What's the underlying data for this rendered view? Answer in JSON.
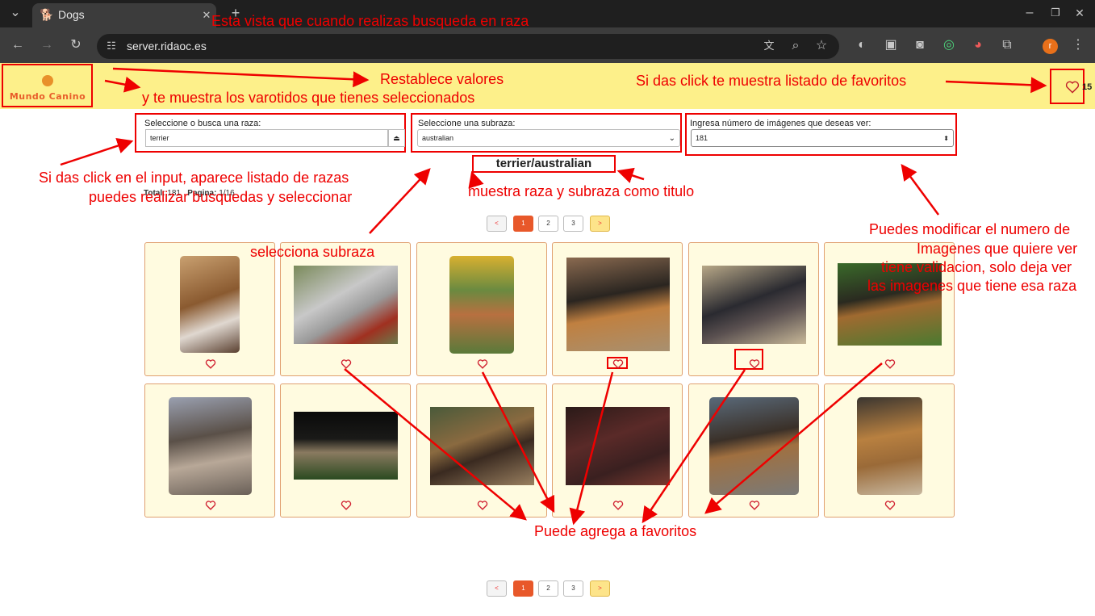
{
  "browser": {
    "tab_title": "Dogs",
    "url": "server.ridaoc.es",
    "profile_initial": "r"
  },
  "header": {
    "logo_text": "Mundo Canino",
    "favorites_count": "15"
  },
  "search": {
    "breed_label": "Seleccione o busca una raza:",
    "breed_value": "terrier",
    "subbreed_label": "Seleccione una subraza:",
    "subbreed_value": "australian",
    "count_label": "Ingresa número de imágenes que deseas ver:",
    "count_value": "181"
  },
  "title": "terrier/australian",
  "stats": {
    "total_label": "Total:",
    "total_value": "181",
    "page_label": "Pagina:",
    "page_value": "1/16"
  },
  "pagination": {
    "prev": "<",
    "pages": [
      "1",
      "2",
      "3"
    ],
    "next": ">"
  },
  "annotations": {
    "top_banner": "Esta vista que cuando realizas busqueda en raza",
    "reset_1": "Restablece valores",
    "reset_2": "y te muestra los varotidos que tienes seleccionados",
    "fav_list": "Si das click te muestra listado de favoritos",
    "input_1": "Si das click en el input, aparece listado de razas",
    "input_2": "puedes realizar busquedas y seleccionar",
    "title_note": "muestra raza y subraza como titulo",
    "subbreed_note": "selecciona subraza",
    "count_1": "Puedes modificar el numero de",
    "count_2": "Imagenes que quiere ver",
    "count_3": "tiene validacion, solo deja ver",
    "count_4": "las imagenes que tiene esa raza",
    "favorites_note": "Puede agrega a favoritos"
  },
  "colors": {
    "header_bg": "#fdf08a",
    "accent": "#e8582a",
    "annotation_red": "#e00000",
    "card_bg": "#fffbe0"
  }
}
